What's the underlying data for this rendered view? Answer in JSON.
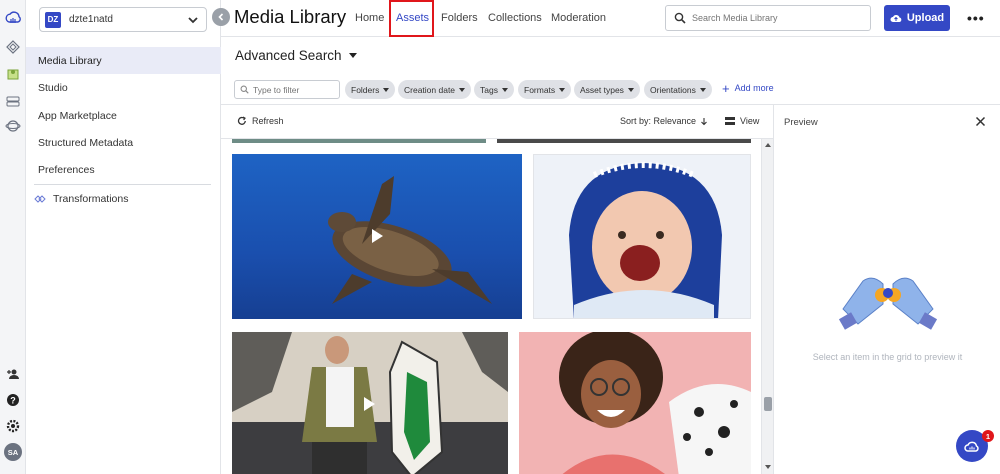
{
  "cloud": {
    "badge": "DZ",
    "name": "dzte1natd"
  },
  "sidebar": {
    "items": [
      {
        "label": "Media Library"
      },
      {
        "label": "Studio"
      },
      {
        "label": "App Marketplace"
      },
      {
        "label": "Structured Metadata"
      },
      {
        "label": "Preferences"
      },
      {
        "label": "Transformations"
      }
    ]
  },
  "header": {
    "title": "Media Library",
    "tabs": [
      "Home",
      "Assets",
      "Folders",
      "Collections",
      "Moderation"
    ],
    "search_placeholder": "Search Media Library",
    "upload_label": "Upload",
    "more_label": "•••"
  },
  "advanced_search": {
    "title": "Advanced Search",
    "filter_placeholder": "Type to filter",
    "chips": [
      "Folders",
      "Creation date",
      "Tags",
      "Formats",
      "Asset types",
      "Orientations"
    ],
    "add_more": "Add more"
  },
  "toolbar": {
    "refresh": "Refresh",
    "sort": "Sort by: Relevance",
    "view": "View"
  },
  "preview": {
    "title": "Preview",
    "hint": "Select an item in the grid to preview it"
  },
  "user": {
    "initials": "SA"
  },
  "chat": {
    "badge": "1"
  },
  "colors": {
    "accent": "#3448c5",
    "highlight": "#e0161b"
  }
}
